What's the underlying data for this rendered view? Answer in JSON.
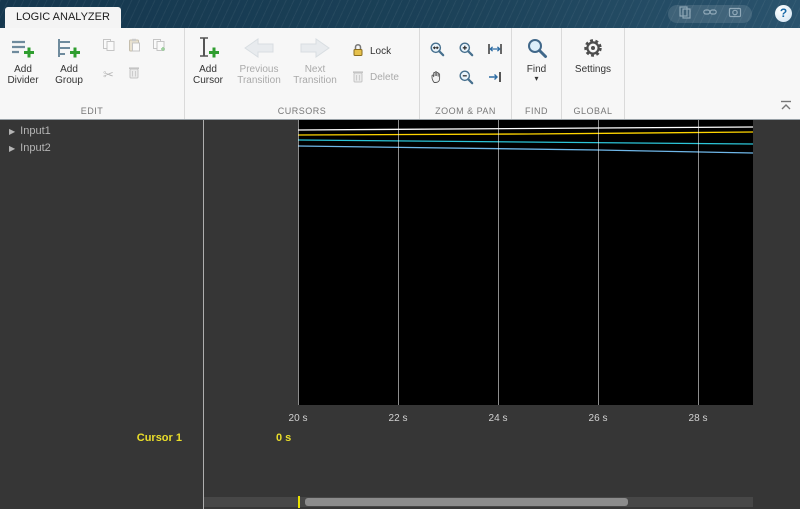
{
  "window": {
    "tab_label": "LOGIC ANALYZER"
  },
  "quick_access": {
    "help_glyph": "?"
  },
  "icons": {
    "expand_glyph": "▶",
    "dropdown_glyph": "▾",
    "scissors_glyph": "✂"
  },
  "toolstrip": {
    "edit": {
      "section_label": "EDIT",
      "add_divider_label": "Add\nDivider",
      "add_group_label": "Add\nGroup"
    },
    "cursors": {
      "section_label": "CURSORS",
      "add_cursor_label": "Add\nCursor",
      "previous_transition_label": "Previous\nTransition",
      "next_transition_label": "Next\nTransition",
      "lock_label": "Lock",
      "delete_label": "Delete"
    },
    "zoom_pan": {
      "section_label": "ZOOM & PAN"
    },
    "find": {
      "section_label": "FIND",
      "find_label": "Find"
    },
    "global": {
      "section_label": "GLOBAL",
      "settings_label": "Settings"
    }
  },
  "waveform": {
    "channels": [
      {
        "label": "Input1"
      },
      {
        "label": "Input2"
      }
    ],
    "axis_ticks": [
      "20 s",
      "22 s",
      "24 s",
      "26 s",
      "28 s"
    ],
    "cursor_name": "Cursor 1",
    "cursor_value": "0 s",
    "trace_colors": [
      "#ffffff",
      "#ffd500",
      "#2cc5d8",
      "#6fb7e8"
    ],
    "cursor_accent_color": "#e8e000"
  }
}
